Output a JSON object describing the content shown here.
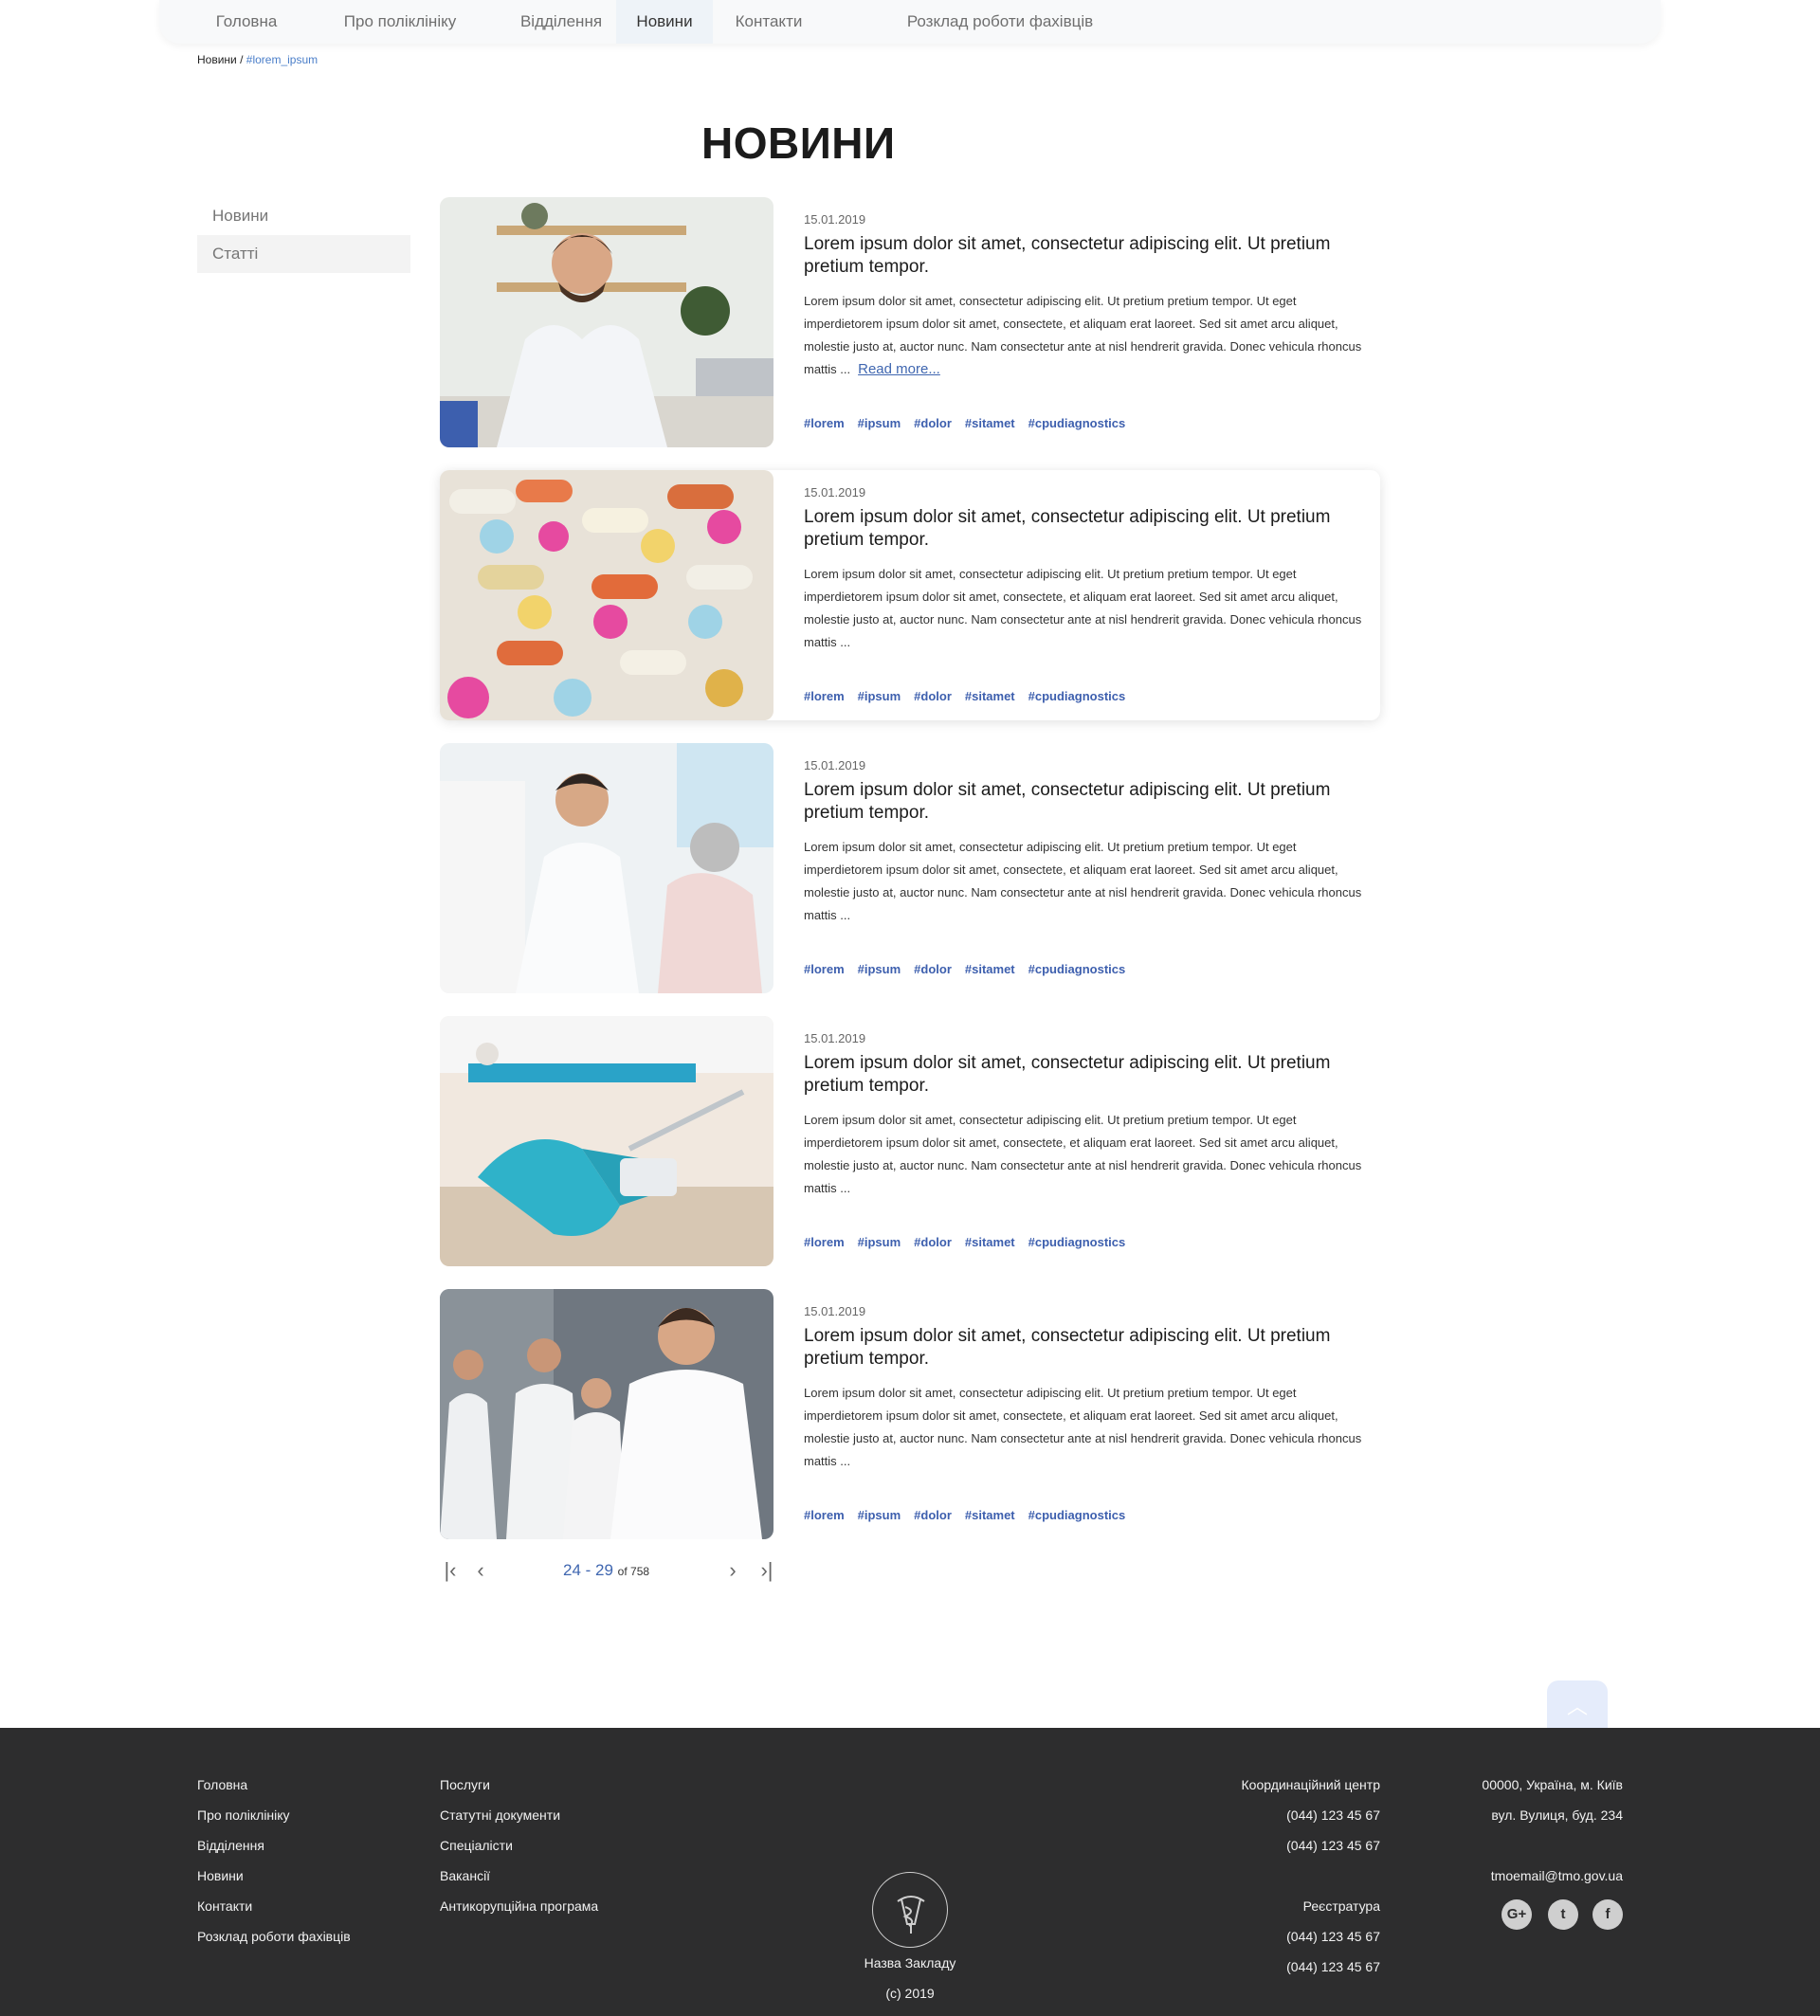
{
  "nav": {
    "items": [
      "Головна",
      "Про поліклініку",
      "Відділення",
      "Новини",
      "Контакти",
      "Розклад роботи фахівців"
    ]
  },
  "breadcrumb": {
    "root": "Новини /",
    "tag": "#lorem_ipsum"
  },
  "page_title": "НОВИНИ",
  "sidebar": {
    "items": [
      "Новини",
      "Статті"
    ]
  },
  "news": [
    {
      "date": "15.01.2019",
      "title": "Lorem ipsum dolor sit amet, consectetur adipiscing elit. Ut pretium pretium tempor.",
      "text": "Lorem ipsum dolor sit amet, consectetur adipiscing elit. Ut pretium pretium tempor. Ut eget imperdietorem ipsum dolor sit amet, consectete, et aliquam erat laoreet. Sed sit amet arcu aliquet, molestie justo at, auctor nunc. Nam consectetur ante at nisl hendrerit gravida. Donec vehicula rhoncus mattis ...",
      "read_more": "Read more...",
      "tags": [
        "#lorem",
        "#ipsum",
        "#dolor",
        "#sitamet",
        "#cpudiagnostics"
      ],
      "image": "doctor-at-desk-photo"
    },
    {
      "date": "15.01.2019",
      "title": "Lorem ipsum dolor sit amet, consectetur adipiscing elit. Ut pretium pretium tempor.",
      "text": "Lorem ipsum dolor sit amet, consectetur adipiscing elit. Ut pretium pretium tempor. Ut eget imperdietorem ipsum dolor sit amet, consectete, et aliquam erat laoreet. Sed sit amet arcu aliquet, molestie justo at, auctor nunc. Nam consectetur ante at nisl hendrerit gravida. Donec vehicula rhoncus mattis ...",
      "tags": [
        "#lorem",
        "#ipsum",
        "#dolor",
        "#sitamet",
        "#cpudiagnostics"
      ],
      "image": "pills-photo"
    },
    {
      "date": "15.01.2019",
      "title": "Lorem ipsum dolor sit amet, consectetur adipiscing elit. Ut pretium pretium tempor.",
      "text": "Lorem ipsum dolor sit amet, consectetur adipiscing elit. Ut pretium pretium tempor. Ut eget imperdietorem ipsum dolor sit amet, consectete, et aliquam erat laoreet. Sed sit amet arcu aliquet, molestie justo at, auctor nunc. Nam consectetur ante at nisl hendrerit gravida. Donec vehicula rhoncus mattis ...",
      "tags": [
        "#lorem",
        "#ipsum",
        "#dolor",
        "#sitamet",
        "#cpudiagnostics"
      ],
      "image": "doctor-with-patient-photo"
    },
    {
      "date": "15.01.2019",
      "title": "Lorem ipsum dolor sit amet, consectetur adipiscing elit. Ut pretium pretium tempor.",
      "text": "Lorem ipsum dolor sit amet, consectetur adipiscing elit. Ut pretium pretium tempor. Ut eget imperdietorem ipsum dolor sit amet, consectete, et aliquam erat laoreet. Sed sit amet arcu aliquet, molestie justo at, auctor nunc. Nam consectetur ante at nisl hendrerit gravida. Donec vehicula rhoncus mattis ...",
      "tags": [
        "#lorem",
        "#ipsum",
        "#dolor",
        "#sitamet",
        "#cpudiagnostics"
      ],
      "image": "dental-chair-photo"
    },
    {
      "date": "15.01.2019",
      "title": "Lorem ipsum dolor sit amet, consectetur adipiscing elit. Ut pretium pretium tempor.",
      "text": "Lorem ipsum dolor sit amet, consectetur adipiscing elit. Ut pretium pretium tempor. Ut eget imperdietorem ipsum dolor sit amet, consectete, et aliquam erat laoreet. Sed sit amet arcu aliquet, molestie justo at, auctor nunc. Nam consectetur ante at nisl hendrerit gravida. Donec vehicula rhoncus mattis ...",
      "tags": [
        "#lorem",
        "#ipsum",
        "#dolor",
        "#sitamet",
        "#cpudiagnostics"
      ],
      "image": "medical-team-photo"
    }
  ],
  "pagination": {
    "range": "24 - 29",
    "of": "of 758"
  },
  "footer": {
    "col1": [
      "Головна",
      "Про поліклініку",
      "Відділення",
      "Новини",
      "Контакти",
      "Розклад роботи фахівців"
    ],
    "col2": [
      "Послуги",
      "Статутні документи",
      "Спеціалісти",
      "Вакансії",
      "Антикорупційна програма"
    ],
    "coord_title": "Координаційний центр",
    "coord_phones": [
      "(044) 123 45 67",
      "(044) 123 45 67"
    ],
    "reg_title": "Реєстратура",
    "reg_phones": [
      "(044) 123 45 67",
      "(044) 123 45 67"
    ],
    "address": [
      "00000, Україна, м. Київ",
      "вул. Вулиця, буд. 234"
    ],
    "email": "tmoemail@tmo.gov.ua",
    "org_name": "Назва Закладу",
    "copyright": "(c) 2019",
    "social": [
      {
        "icon": "google-plus-icon",
        "glyph": "G+"
      },
      {
        "icon": "twitter-icon",
        "glyph": "t"
      },
      {
        "icon": "facebook-icon",
        "glyph": "f"
      }
    ]
  },
  "colors": {
    "accent": "#3f66b0",
    "tag": "#3d5fae",
    "footer_bg": "#2d2d2e",
    "nav_bg": "#f8f9fa"
  }
}
